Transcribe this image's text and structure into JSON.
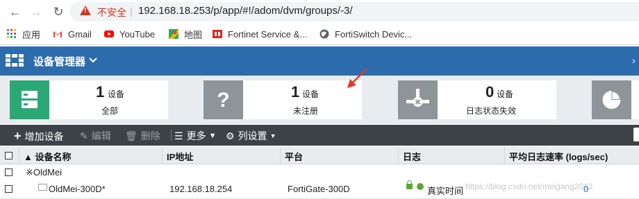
{
  "browser": {
    "security_label": "不安全",
    "separator": "|",
    "url": "192.168.18.253/p/app/#!/adom/dvm/groups/-3/",
    "bookmarks": [
      {
        "label": "应用"
      },
      {
        "label": "Gmail"
      },
      {
        "label": "YouTube"
      },
      {
        "label": "地图"
      },
      {
        "label": "Fortinet Service &..."
      },
      {
        "label": "FortiSwitch Devic..."
      }
    ]
  },
  "header": {
    "title": "设备管理器",
    "right_glyph": "›"
  },
  "summary": [
    {
      "count": "1",
      "unit": "设备",
      "label": "全部",
      "color": "#2aa876",
      "icon": "server-icon"
    },
    {
      "count": "1",
      "unit": "设备",
      "label": "未注册",
      "color": "#8e9599",
      "icon": "question-icon"
    },
    {
      "count": "0",
      "unit": "设备",
      "label": "日志状态失效",
      "color": "#8e9599",
      "icon": "log-failed-icon"
    },
    {
      "count": "",
      "unit": "",
      "label": "",
      "color": "#8e9599",
      "icon": "pie-icon"
    }
  ],
  "toolbar": {
    "add_device": "增加设备",
    "edit": "编辑",
    "delete": "删除",
    "more": "更多",
    "column_settings": "列设置"
  },
  "table": {
    "headers": {
      "name": "▲ 设备名称",
      "ip": "IP地址",
      "platform": "平台",
      "log": "日志",
      "log_rate": "平均日志速率 (logs/sec)"
    },
    "group_row": {
      "name": "※OldMei"
    },
    "device_row": {
      "name": "OldMei-300D*",
      "ip": "192.168.18.254",
      "platform": "FortiGate-300D",
      "log": "真实时间",
      "log_rate": "0"
    }
  },
  "watermark": "https://blog.csdn.net/meigang2012",
  "colors": {
    "header_bg": "#2d6cac",
    "toolbar_bg": "#3c4248",
    "accent_green": "#2aa876",
    "annotation_red": "#e8352c"
  }
}
